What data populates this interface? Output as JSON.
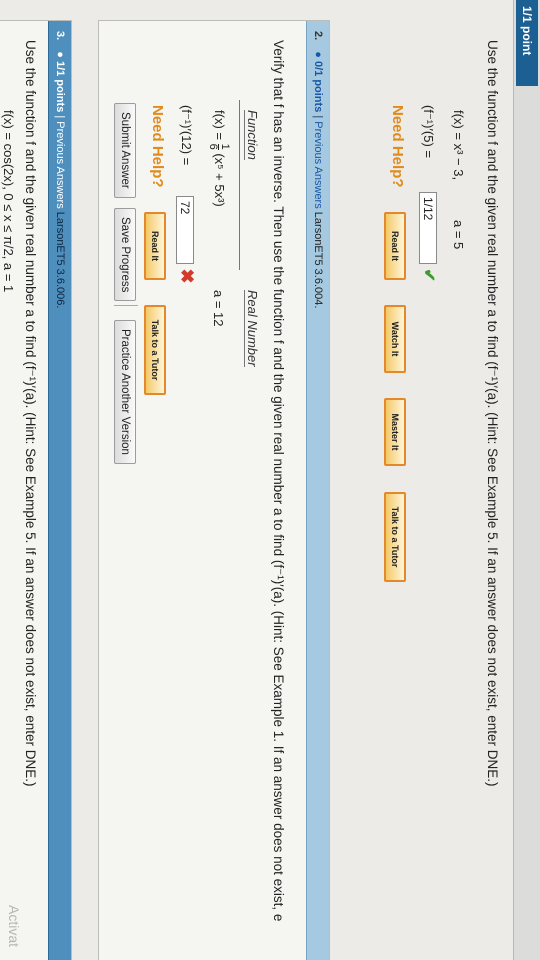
{
  "header": {
    "fragment": "1/1 point"
  },
  "q1": {
    "instruction": "Use the function f and the given real number a to find (f⁻¹)′(a). (Hint: See Example 5. If an answer does not exist, enter DNE.)",
    "function": "f(x) = x³ − 3,",
    "a_value": "a = 5",
    "answer_label": "(f⁻¹)′(5) =",
    "answer": "1/12",
    "need_help": "Need Help?",
    "buttons": [
      "Read It",
      "Watch It",
      "Master It",
      "Talk to a Tutor"
    ]
  },
  "q2": {
    "number": "2.",
    "points": "0/1 points",
    "separator": "|",
    "previous_answers": "Previous Answers",
    "source": "LarsonET5 3.6.004.",
    "instruction": "Verify that f has an inverse. Then use the function f and the given real number a to find (f⁻¹)′(a). (Hint: See Example 1. If an answer does not exist, e",
    "col_function": "Function",
    "col_real_number": "Real Number",
    "function": "f(x) = ",
    "frac_num": "1",
    "frac_den": "6",
    "function_rest": "(x⁵ + 5x³)",
    "a_value": "a = 12",
    "answer_label": "(f⁻¹)′(12) =",
    "answer": "72",
    "need_help": "Need Help?",
    "buttons": [
      "Read It",
      "Talk to a Tutor"
    ],
    "submit": "Submit Answer",
    "save": "Save Progress",
    "practice": "Practice Another Version"
  },
  "q3": {
    "number": "3.",
    "points": "1/1 points",
    "separator": "|",
    "previous_answers": "Previous Answers",
    "source": "LarsonET5 3.6.006.",
    "instruction": "Use the function f and the given real number a to find (f⁻¹)′(a). (Hint: See Example 5. If an answer does not exist, enter DNE.)",
    "function": "f(x) = cos(2x),   0 ≤ x ≤ π/2, a = 1"
  },
  "watermark": "Activat",
  "colors": {
    "header_blue": "#a5c9e0",
    "link_blue": "#1a56a6",
    "need_help_orange": "#e28b1b",
    "check_green": "#3a9c2b",
    "cross_red": "#d23a2a"
  }
}
